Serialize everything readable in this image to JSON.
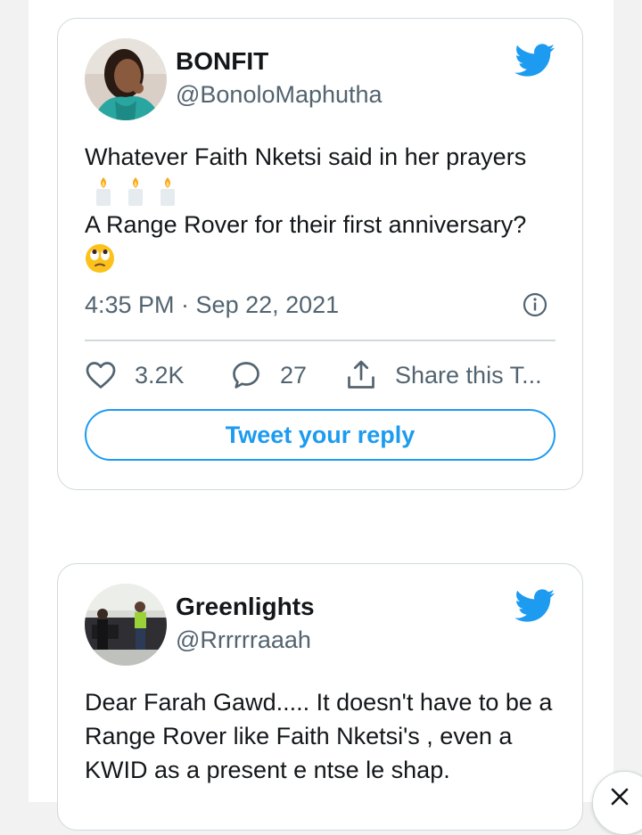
{
  "tweets": [
    {
      "display_name": "BONFIT",
      "handle": "@BonoloMaphutha",
      "text_line1": "Whatever Faith Nketsi said in her prayers",
      "emoji_line1": [
        "candle-emoji",
        "candle-emoji",
        "candle-emoji"
      ],
      "text_line2": "A Range Rover for their first anniversary?",
      "emoji_line2": [
        "face-with-rolling-eyes-emoji"
      ],
      "timestamp": "4:35 PM · Sep 22, 2021",
      "likes": "3.2K",
      "replies": "27",
      "share_label": "Share this T...",
      "reply_button_label": "Tweet your reply"
    },
    {
      "display_name": "Greenlights",
      "handle": "@Rrrrrraaah",
      "text_lines": [
        "Dear Farah Gawd..... It doesn't have to be a",
        "Range Rover like Faith Nketsi's , even a",
        "KWID as a present e ntse le shap."
      ]
    }
  ],
  "icons": {
    "brand": "twitter-bird-icon",
    "info": "info-icon",
    "like": "heart-icon",
    "reply": "speech-bubble-icon",
    "share": "share-upload-icon",
    "close": "close-icon"
  },
  "colors": {
    "twitter_blue": "#1d9bf0",
    "text_primary": "#14171a",
    "text_secondary": "#536471",
    "border": "#cfd9de"
  }
}
